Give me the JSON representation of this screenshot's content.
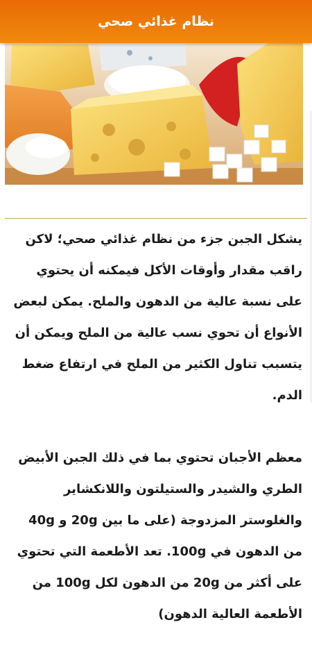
{
  "app_bar": {
    "title": "نظام غذائي صحي",
    "background_colors": [
      "#e96a06",
      "#f08a0c"
    ]
  },
  "hero_image": {
    "subject": "cheese-assortment"
  },
  "article": {
    "paragraphs": [
      "يشكل الجبن جزء من نظام غذائي صحي؛ لاكن راقب مقدار وأوقات الأكل فيمكنه أن يحتوي على نسبة عالية من الدهون والملح. يمكن لبعض الأنواع أن تحوي نسب عالية من الملح ويمكن أن يتسبب تناول الكثير من الملح في ارتفاع ضغط الدم.",
      "معظم الأجبان تحتوي بما في ذلك الجبن الأبيض الطري والشيدر والستيلتون واللانكشاير والغلوستر المزدوجة (على ما بين 20g و 40g من الدهون في 100g. تعد الأطعمة التي تحتوي على أكثر من 20g من الدهون لكل 100g من الأطعمة العالية الدهون)"
    ]
  },
  "colors": {
    "accent": "#ef7f0a",
    "divider": "#c4a75a",
    "text": "#1a1a1a"
  }
}
